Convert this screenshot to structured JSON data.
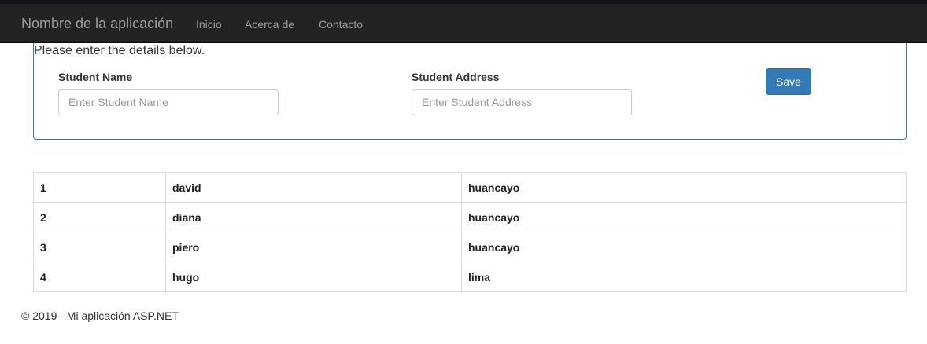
{
  "navbar": {
    "brand": "Nombre de la aplicación",
    "links": [
      "Inicio",
      "Acerca de",
      "Contacto"
    ]
  },
  "form": {
    "heading": "Please enter the details below.",
    "name_label": "Student Name",
    "name_placeholder": "Enter Student Name",
    "name_value": "",
    "address_label": "Student Address",
    "address_placeholder": "Enter Student Address",
    "address_value": "",
    "save_label": "Save"
  },
  "table": {
    "rows": [
      [
        "1",
        "david",
        "huancayo"
      ],
      [
        "2",
        "diana",
        "huancayo"
      ],
      [
        "3",
        "piero",
        "huancayo"
      ],
      [
        "4",
        "hugo",
        "lima"
      ]
    ]
  },
  "footer": {
    "text": "© 2019 - Mi aplicación ASP.NET"
  },
  "colors": {
    "navbar_bg": "#222222",
    "nav_text": "#9d9d9d",
    "panel_border": "#337ab7",
    "button_bg": "#337ab7"
  }
}
